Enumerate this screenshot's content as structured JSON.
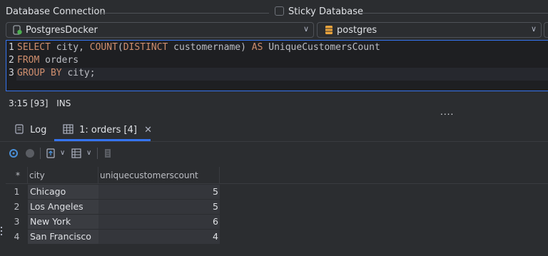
{
  "connection": {
    "section_label": "Database Connection",
    "sticky_label": "Sticky Database",
    "sticky_checked": false,
    "datasource": "PostgresDocker",
    "database": "postgres"
  },
  "editor": {
    "line_numbers": [
      "1",
      "2",
      "3"
    ],
    "lines": [
      [
        {
          "t": "SELECT",
          "k": "kw"
        },
        {
          "t": " city, ",
          "k": "id"
        },
        {
          "t": "COUNT",
          "k": "kw"
        },
        {
          "t": "(",
          "k": "id"
        },
        {
          "t": "DISTINCT",
          "k": "kw"
        },
        {
          "t": " customername) ",
          "k": "id"
        },
        {
          "t": "AS",
          "k": "kw"
        },
        {
          "t": " UniqueCustomersCount",
          "k": "id"
        }
      ],
      [
        {
          "t": "FROM",
          "k": "kw"
        },
        {
          "t": " orders",
          "k": "id"
        }
      ],
      [
        {
          "t": "GROUP BY",
          "k": "kw"
        },
        {
          "t": " city;",
          "k": "id"
        }
      ]
    ]
  },
  "status": {
    "position": "3:15 [93]",
    "mode": "INS",
    "more": "...."
  },
  "tabs": [
    {
      "label": "Log",
      "icon": "log-icon",
      "active": false
    },
    {
      "label": "1: orders [4]",
      "icon": "table-icon",
      "active": true,
      "closable": true
    }
  ],
  "results": {
    "row_header": "*",
    "columns": [
      "city",
      "uniquecustomerscount"
    ],
    "rows": [
      {
        "num": "1",
        "city": "Chicago",
        "count": "5"
      },
      {
        "num": "2",
        "city": "Los Angeles",
        "count": "5"
      },
      {
        "num": "3",
        "city": "New York",
        "count": "6"
      },
      {
        "num": "4",
        "city": "San Francisco",
        "count": "4"
      }
    ]
  },
  "colors": {
    "background": "#2b2d30",
    "editor_bg": "#1e1f22",
    "keyword": "#cf8e6d",
    "accent": "#3574f0"
  }
}
